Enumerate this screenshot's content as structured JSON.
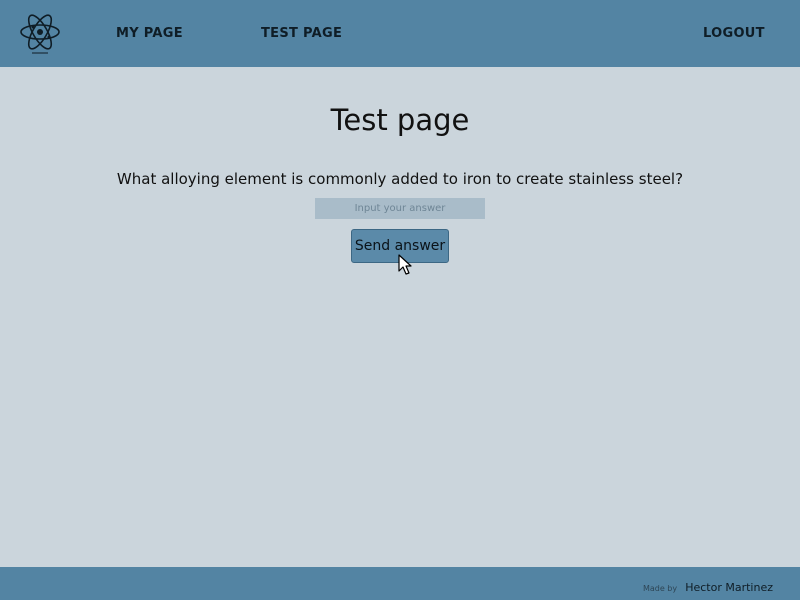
{
  "header": {
    "logo_icon": "atom-icon",
    "nav": {
      "my_page": "MY PAGE",
      "test_page": "TEST PAGE",
      "logout": "LOGOUT"
    }
  },
  "main": {
    "title": "Test page",
    "question": "What alloying element is commonly added to iron to create stainless steel?",
    "answer_input": {
      "value": "",
      "placeholder": "Input your answer"
    },
    "send_button_label": "Send answer"
  },
  "footer": {
    "credit_prefix": "Made by",
    "credit_name": "Hector Martinez"
  },
  "colors": {
    "header_bg": "#5384a3",
    "page_bg": "#cbd5dc",
    "input_bg": "#a9bcc9",
    "button_bg": "#5b8aa9"
  }
}
